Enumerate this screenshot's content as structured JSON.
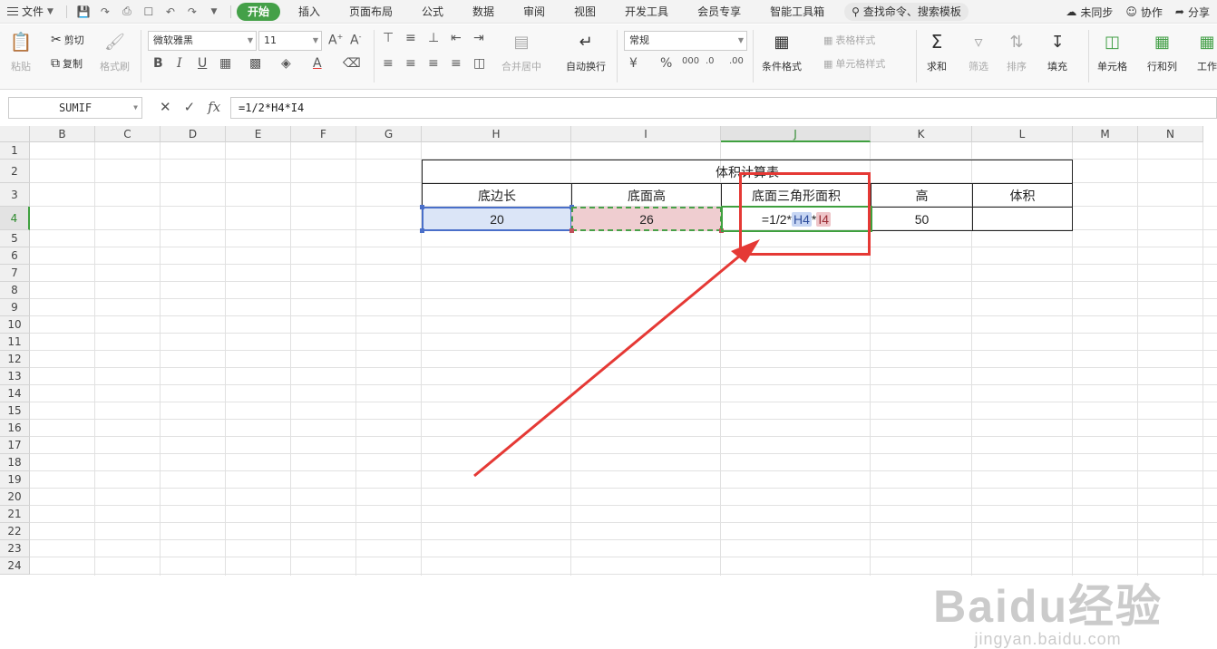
{
  "menubar": {
    "file_label": "文件",
    "tabs": [
      {
        "label": "开始",
        "active": true
      },
      {
        "label": "插入",
        "active": false
      },
      {
        "label": "页面布局",
        "active": false
      },
      {
        "label": "公式",
        "active": false
      },
      {
        "label": "数据",
        "active": false
      },
      {
        "label": "审阅",
        "active": false
      },
      {
        "label": "视图",
        "active": false
      },
      {
        "label": "开发工具",
        "active": false
      },
      {
        "label": "会员专享",
        "active": false
      },
      {
        "label": "智能工具箱",
        "active": false
      }
    ],
    "search_label": "查找命令、搜索模板",
    "sync_label": "未同步",
    "collab_label": "协作",
    "share_label": "分享"
  },
  "ribbon": {
    "paste_label": "粘贴",
    "cut_label": "剪切",
    "copy_label": "复制",
    "format_painter_label": "格式刷",
    "font_name": "微软雅黑",
    "font_size": "11",
    "merge_label": "合并居中",
    "wrap_label": "自动换行",
    "number_format": "常规",
    "cond_format_label": "条件格式",
    "table_style_label": "表格样式",
    "cell_style_label": "单元格样式",
    "sum_label": "求和",
    "filter_label": "筛选",
    "sort_label": "排序",
    "fill_label": "填充",
    "cell_label": "单元格",
    "rowcol_label": "行和列",
    "worksheet_label": "工作"
  },
  "formula_bar": {
    "name_box": "SUMIF",
    "formula": "=1/2*H4*I4",
    "fx_label": "fx"
  },
  "columns": [
    "B",
    "C",
    "D",
    "E",
    "F",
    "G",
    "H",
    "I",
    "J",
    "K",
    "L",
    "M",
    "N"
  ],
  "rows": [
    "1",
    "2",
    "3",
    "4",
    "5",
    "6",
    "7",
    "8",
    "9",
    "10",
    "11",
    "12",
    "13",
    "14",
    "15",
    "16",
    "17",
    "18",
    "19",
    "20",
    "21",
    "22",
    "23",
    "24"
  ],
  "table": {
    "title": "体积计算表",
    "headers": [
      "底边长",
      "底面高",
      "底面三角形面积",
      "高",
      "体积"
    ],
    "row4": {
      "H": "20",
      "I": "26",
      "J_prefix": "=1/2*",
      "J_ref1": "H4",
      "J_mid": "*",
      "J_ref2": "I4",
      "K": "50",
      "L": ""
    }
  },
  "watermark": {
    "logo": "Baidu经验",
    "sub": "jingyan.baidu.com"
  },
  "colors": {
    "accent_green": "#44a048",
    "annotation_red": "#e53935",
    "ref_blue": "#4a6fc9",
    "ref_pink": "#efcdd0"
  }
}
